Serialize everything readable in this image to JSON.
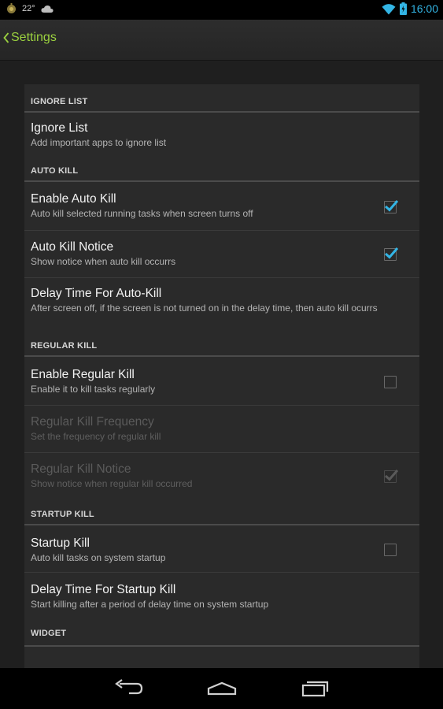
{
  "status_bar": {
    "temperature": "22°",
    "time": "16:00",
    "left_icons": [
      "app-notification-icon",
      "cloud-icon"
    ],
    "right_icons": [
      "wifi-icon",
      "battery-icon"
    ]
  },
  "action_bar": {
    "title": "Settings",
    "accent_color": "#9bd13f"
  },
  "settings": {
    "ignore_list_header": "IGNORE LIST",
    "ignore_list": {
      "title": "Ignore List",
      "summary": "Add important apps to ignore list"
    },
    "auto_kill_header": "AUTO KILL",
    "enable_auto_kill": {
      "title": "Enable Auto Kill",
      "summary": "Auto kill selected running tasks when screen turns off",
      "checked": true
    },
    "auto_kill_notice": {
      "title": "Auto Kill Notice",
      "summary": "Show notice when auto kill occurrs",
      "checked": true
    },
    "delay_auto_kill": {
      "title": "Delay Time For Auto-Kill",
      "summary": "After screen off, if the screen is not turned on in the delay time, then auto kill ocurrs"
    },
    "regular_kill_header": "REGULAR KILL",
    "enable_regular_kill": {
      "title": "Enable Regular Kill",
      "summary": "Enable it to kill tasks regularly",
      "checked": false
    },
    "regular_kill_frequency": {
      "title": "Regular Kill Frequency",
      "summary": "Set the frequency of regular kill",
      "enabled": false
    },
    "regular_kill_notice": {
      "title": "Regular Kill Notice",
      "summary": "Show notice when regular kill occurred",
      "checked": true,
      "enabled": false
    },
    "startup_kill_header": "STARTUP KILL",
    "startup_kill": {
      "title": "Startup Kill",
      "summary": "Auto kill tasks on system startup",
      "checked": false
    },
    "delay_startup_kill": {
      "title": "Delay Time For Startup Kill",
      "summary": "Start killing after a period of delay time on system startup"
    },
    "widget_header": "WIDGET"
  },
  "colors": {
    "check_blue": "#33b5e5",
    "status_time": "#33b5e5"
  },
  "nav_bar": {
    "icons": [
      "back-icon",
      "home-icon",
      "recent-apps-icon"
    ]
  }
}
